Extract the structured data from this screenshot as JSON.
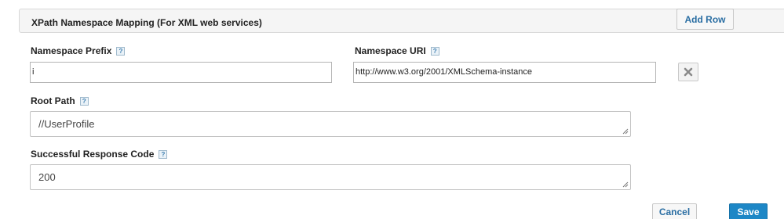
{
  "section": {
    "title": "XPath Namespace Mapping (For XML web services)",
    "add_row_label": "Add Row"
  },
  "namespace_prefix": {
    "label": "Namespace Prefix",
    "value": "i",
    "help_icon": "help-icon"
  },
  "namespace_uri": {
    "label": "Namespace URI",
    "value": "http://www.w3.org/2001/XMLSchema-instance",
    "help_icon": "help-icon"
  },
  "remove_row": {
    "icon": "close-icon"
  },
  "root_path": {
    "label": "Root Path",
    "value": "//UserProfile",
    "help_icon": "help-icon"
  },
  "response_code": {
    "label": "Successful Response Code",
    "value": "200",
    "help_icon": "help-icon"
  },
  "help_glyph": "?",
  "actions": {
    "cancel_label": "Cancel",
    "save_label": "Save"
  },
  "colors": {
    "link": "#2a6ea3",
    "primary": "#1d87c6",
    "header_bg": "#f5f5f5"
  }
}
